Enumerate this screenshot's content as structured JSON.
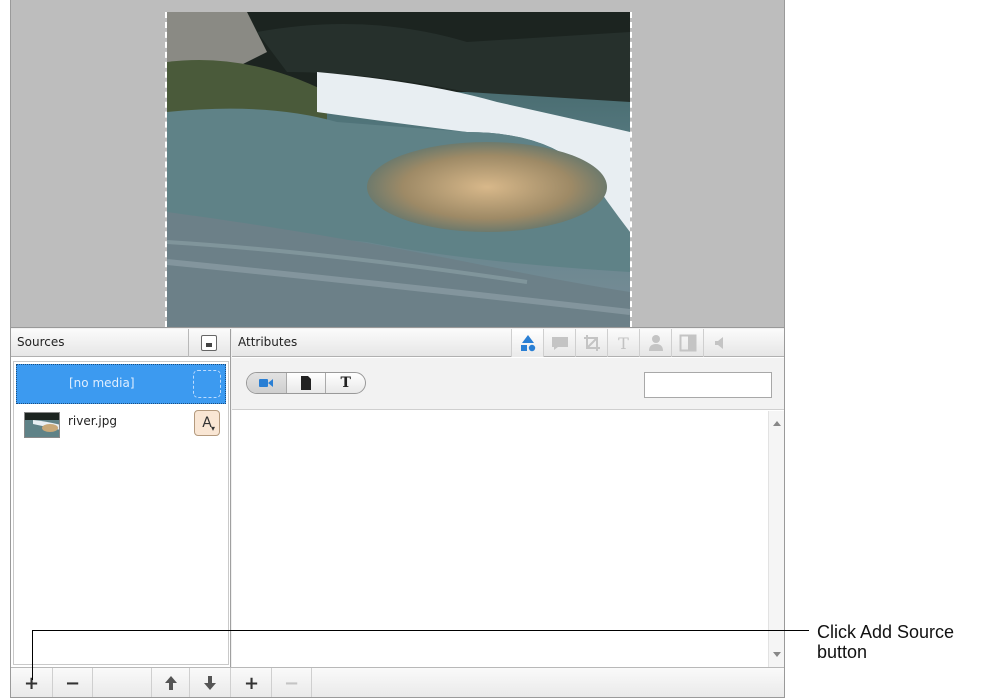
{
  "sources": {
    "title": "Sources",
    "items": [
      {
        "label": "[no media]",
        "selected": true
      },
      {
        "label": "river.jpg",
        "selected": false,
        "action_label": "A"
      }
    ]
  },
  "attributes": {
    "title": "Attributes",
    "tools": [
      "shapes-icon",
      "caption-icon",
      "crop-icon",
      "text-icon",
      "person-icon",
      "split-icon",
      "audio-icon"
    ],
    "type_segments": [
      "video-camera-icon",
      "document-icon",
      "T"
    ],
    "search_value": ""
  },
  "toolbar": {
    "add_label": "+",
    "remove_label": "−",
    "up_label": "🡅",
    "down_label": "🡇",
    "attr_add_label": "+",
    "attr_remove_label": "−"
  },
  "callout": {
    "text": "Click Add Source button"
  },
  "colors": {
    "selection_blue": "#3c9af0",
    "active_tool_blue": "#2a7fd4",
    "preview_background": "#bdbdbd"
  }
}
